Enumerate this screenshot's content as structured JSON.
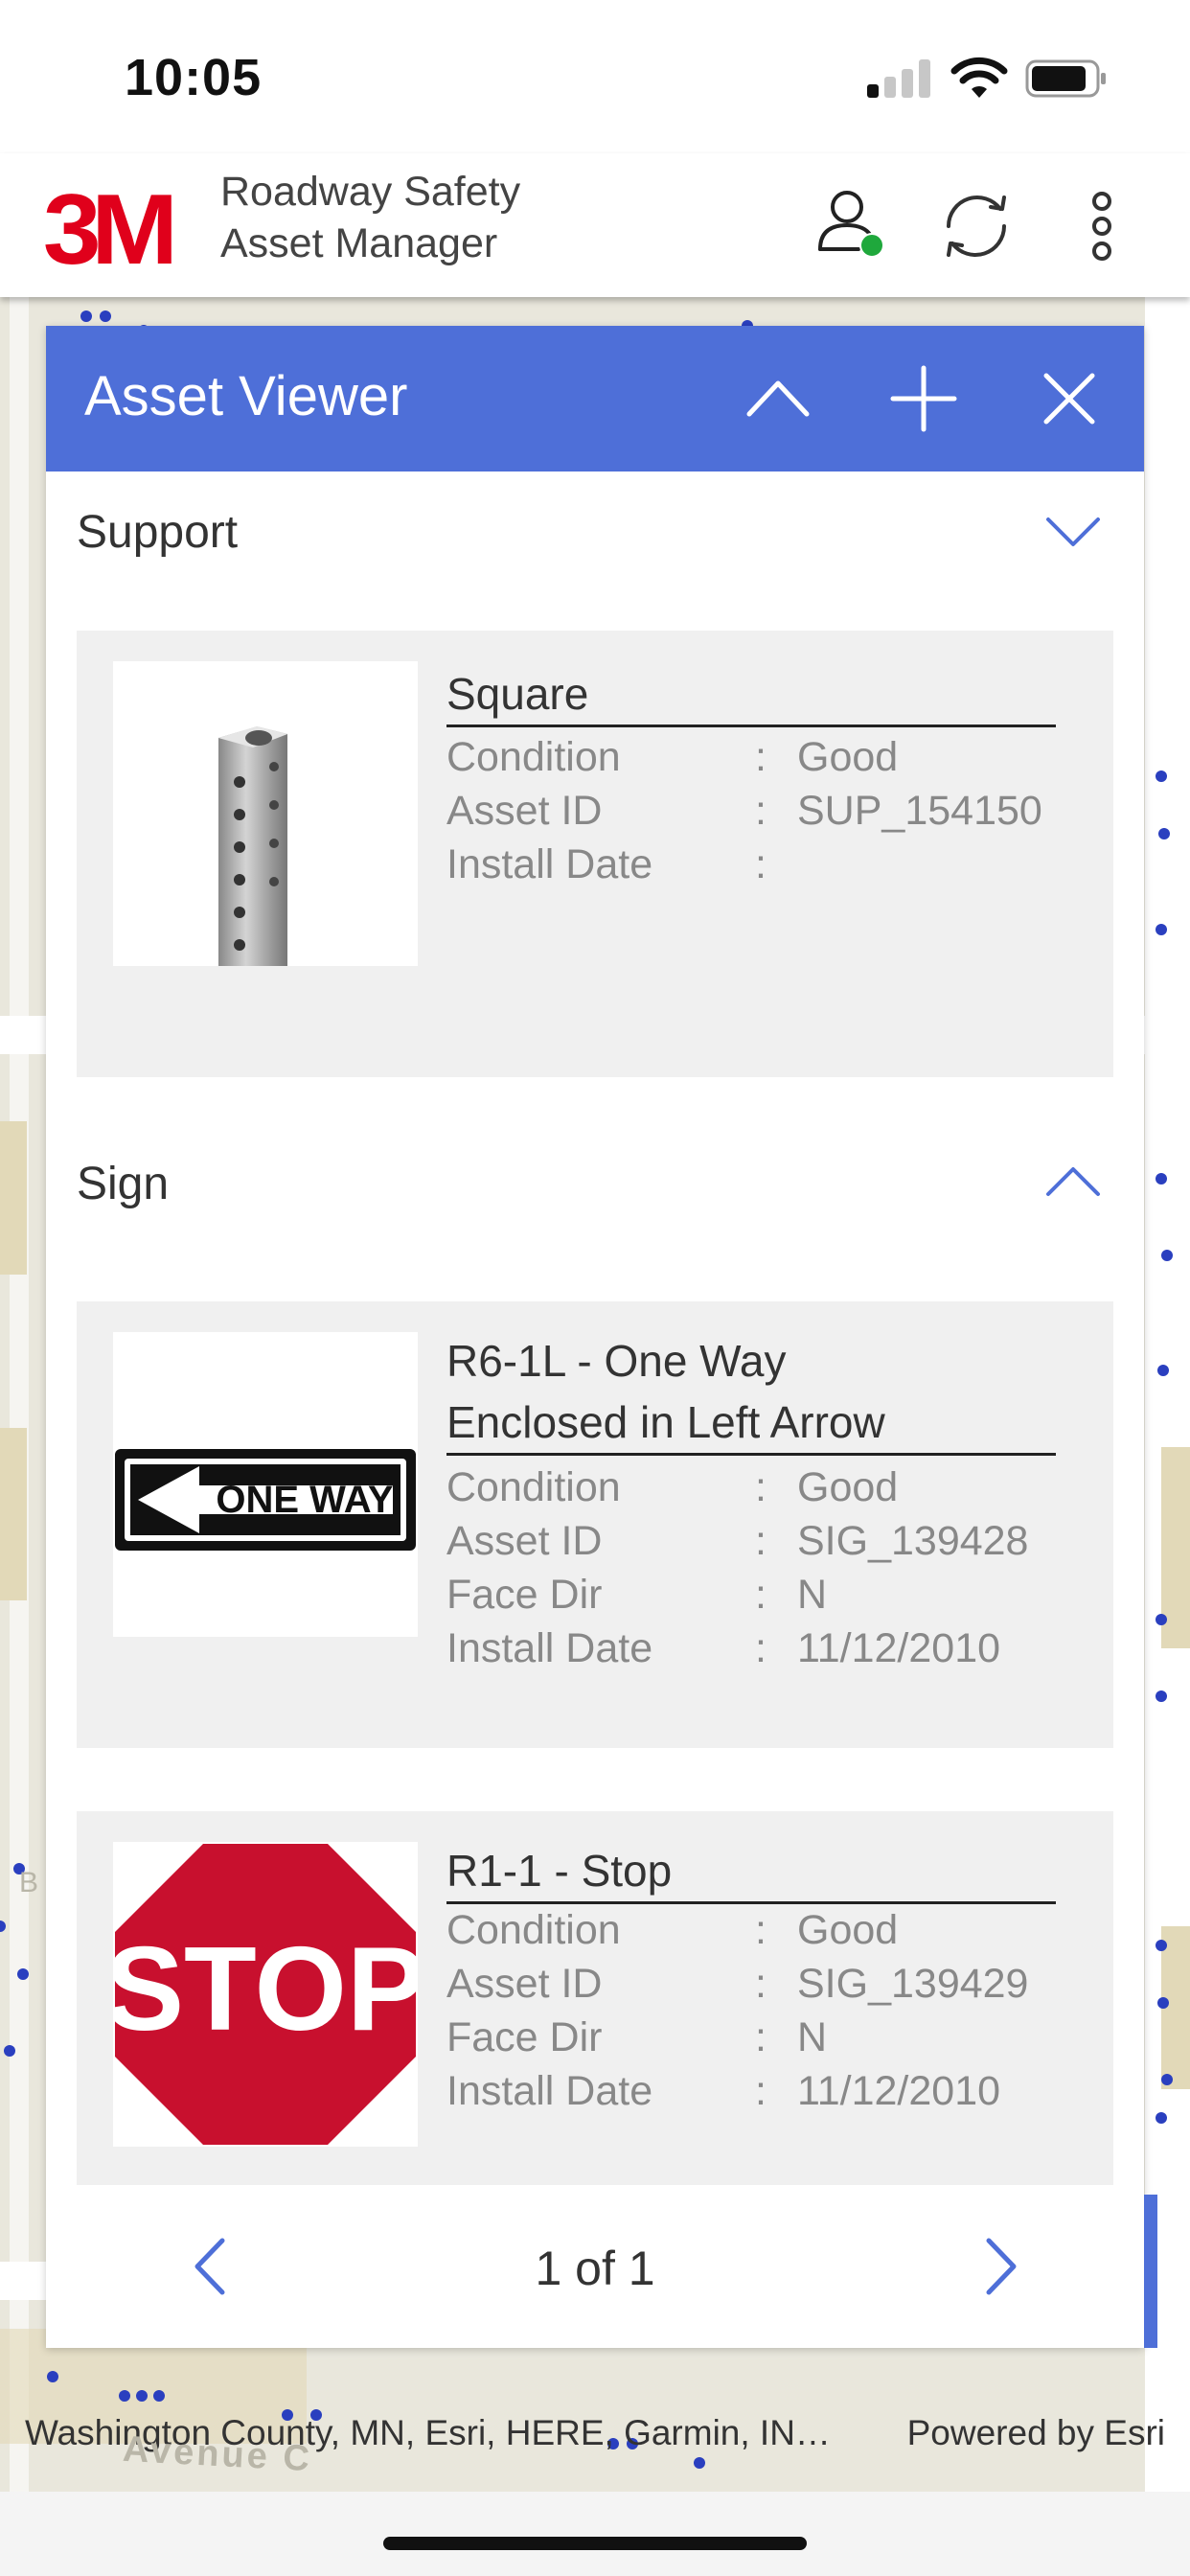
{
  "status_bar": {
    "time": "10:05",
    "icons": [
      "cellular-signal-icon",
      "wifi-icon",
      "battery-icon"
    ]
  },
  "app_header": {
    "logo_text": "3M",
    "title_line1": "Roadway Safety",
    "title_line2": "Asset Manager",
    "icons": [
      "user-status-icon",
      "sync-icon",
      "more-vertical-icon"
    ],
    "status_dot_color": "#1fa83c"
  },
  "asset_viewer": {
    "title": "Asset Viewer",
    "header_color": "#4e6fd8",
    "buttons": [
      "collapse-icon",
      "add-icon",
      "close-icon"
    ],
    "sections": [
      {
        "title": "Support",
        "expanded": false,
        "items": [
          {
            "title": "Square",
            "image": "square-post-image",
            "attributes": [
              {
                "label": "Condition",
                "value": "Good"
              },
              {
                "label": "Asset ID",
                "value": "SUP_154150"
              },
              {
                "label": "Install Date",
                "value": ""
              }
            ]
          }
        ]
      },
      {
        "title": "Sign",
        "expanded": true,
        "items": [
          {
            "title_line1": "R6-1L - One Way",
            "title_line2": "Enclosed in Left Arrow",
            "image": "one-way-sign-image",
            "image_text": "ONE WAY",
            "attributes": [
              {
                "label": "Condition",
                "value": "Good"
              },
              {
                "label": "Asset ID",
                "value": "SIG_139428"
              },
              {
                "label": "Face Dir",
                "value": "N"
              },
              {
                "label": "Install Date",
                "value": "11/12/2010"
              }
            ]
          },
          {
            "title": "R1-1 - Stop",
            "image": "stop-sign-image",
            "image_text": "STOP",
            "attributes": [
              {
                "label": "Condition",
                "value": "Good"
              },
              {
                "label": "Asset ID",
                "value": "SIG_139429"
              },
              {
                "label": "Face Dir",
                "value": "N"
              },
              {
                "label": "Install Date",
                "value": "11/12/2010"
              }
            ]
          }
        ]
      }
    ],
    "pager": {
      "text": "1 of 1"
    }
  },
  "map": {
    "street_label": "Avenue C",
    "street_label_partial": "B",
    "attribution": "Washington County, MN, Esri, HERE, Garmin, IN…",
    "powered_by": "Powered by Esri",
    "point_color": "#2a3fbf"
  }
}
